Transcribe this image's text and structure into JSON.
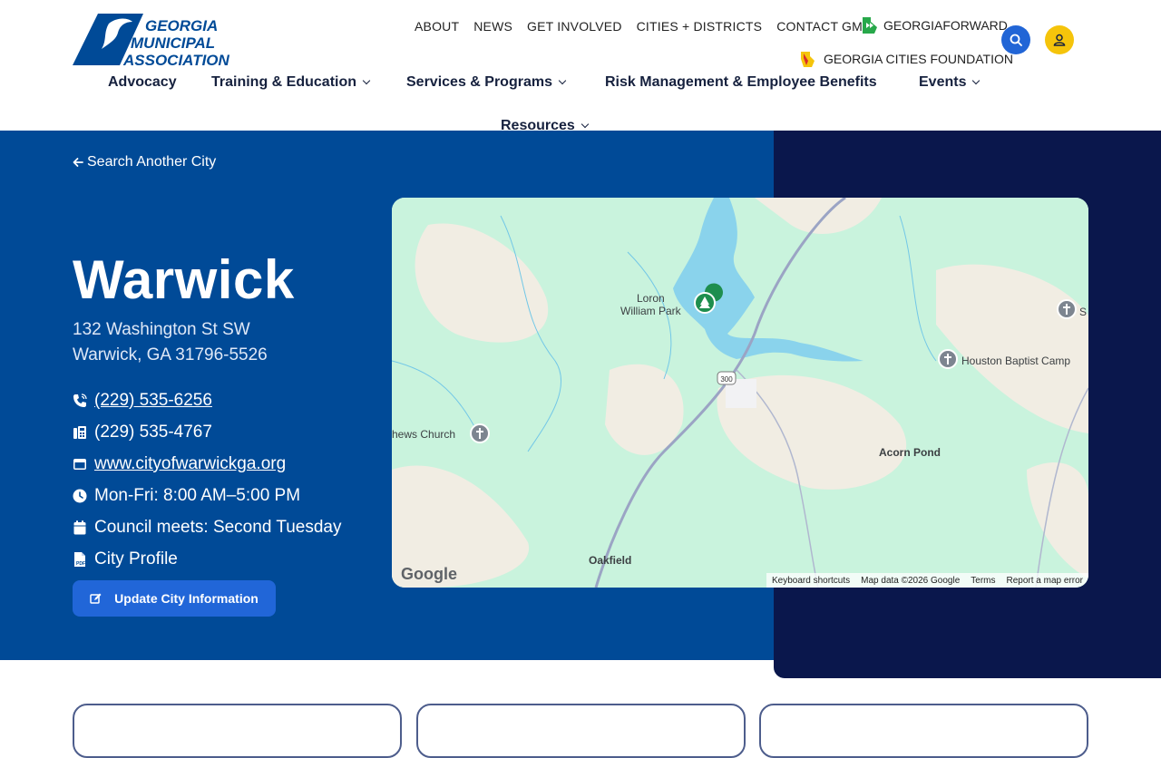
{
  "header": {
    "logo_text": [
      "GEORGIA",
      "MUNICIPAL",
      "ASSOCIATION"
    ],
    "top_nav": [
      "ABOUT",
      "NEWS",
      "GET INVOLVED",
      "CITIES + DISTRICTS",
      "CONTACT GMA"
    ],
    "georgia_forward": "GEORGIAFORWARD",
    "georgia_cities_foundation": "GEORGIA CITIES FOUNDATION",
    "search_icon": "search-icon",
    "user_icon": "user-icon",
    "brand_blue": "#004a97",
    "accent_yellow": "#f5c40b"
  },
  "main_nav": {
    "advocacy": "Advocacy",
    "training": "Training & Education",
    "services": "Services & Programs",
    "risk": "Risk Management & Employee Benefits",
    "events": "Events",
    "resources": "Resources"
  },
  "city": {
    "back_link": "Search Another City",
    "name": "Warwick",
    "address_line1": "132 Washington St SW",
    "address_line2": "Warwick, GA 31796-5526",
    "phone": "(229) 535-6256",
    "fax": "(229) 535-4767",
    "website": "www.cityofwarwickga.org",
    "hours": "Mon-Fri: 8:00 AM–5:00 PM",
    "council": "Council meets: Second Tuesday",
    "profile": "City Profile",
    "update_button": "Update City Information"
  },
  "map": {
    "labels": {
      "park": "Loron\nWilliam Park",
      "church": "hews Church",
      "camp": "Houston Baptist Camp",
      "pond": "Acorn Pond",
      "oakfield": "Oakfield",
      "route": "300",
      "s": "S"
    },
    "google": "Google",
    "footer": {
      "shortcuts": "Keyboard shortcuts",
      "data": "Map data ©2026 Google",
      "terms": "Terms",
      "report": "Report a map error"
    }
  }
}
